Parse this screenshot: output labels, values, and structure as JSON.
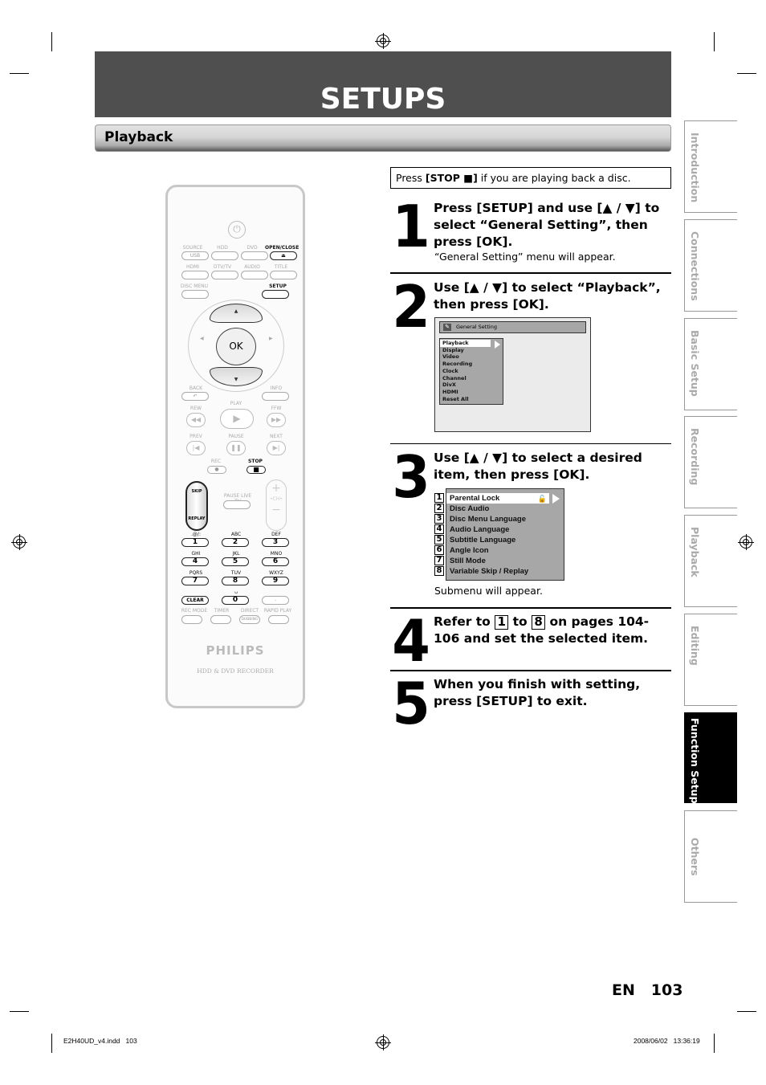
{
  "header": {
    "title": "SETUPS",
    "section": "Playback"
  },
  "note": {
    "prefix": "Press ",
    "key": "[STOP ■]",
    "suffix": " if you are playing back a disc."
  },
  "steps": [
    {
      "number": "1",
      "text": "Press [SETUP] and use [▲ / ▼] to select “General Setting”, then press [OK].",
      "sub": "“General Setting” menu will appear."
    },
    {
      "number": "2",
      "text": "Use [▲ / ▼] to select “Playback”, then press [OK]."
    },
    {
      "number": "3",
      "text": "Use [▲ / ▼] to select a desired item, then press [OK].",
      "sub": "Submenu will appear."
    },
    {
      "number": "4",
      "text_a": "Refer to ",
      "box_a": "1",
      "text_b": " to ",
      "box_b": "8",
      "text_c": " on pages 104-106 and set the selected item."
    },
    {
      "number": "5",
      "text": "When you finish with setting, press [SETUP] to exit."
    }
  ],
  "general_setting_screen": {
    "title": "General Setting",
    "items": [
      "Playback",
      "Display",
      "Video",
      "Recording",
      "Clock",
      "Channel",
      "DivX",
      "HDMI",
      "Reset All"
    ],
    "selected": "Playback"
  },
  "playback_menu": {
    "numbers": [
      "1",
      "2",
      "3",
      "4",
      "5",
      "6",
      "7",
      "8"
    ],
    "items": [
      "Parental Lock",
      "Disc Audio",
      "Disc Menu Language",
      "Audio Language",
      "Subtitle Language",
      "Angle Icon",
      "Still Mode",
      "Variable Skip / Replay"
    ],
    "selected": "Parental Lock",
    "lock_icon": "🔓"
  },
  "remote": {
    "brand": "PHILIPS",
    "model": "HDD & DVD RECORDER",
    "labels": {
      "source": "SOURCE",
      "usb": "USB",
      "hdd": "HDD",
      "dvd": "DVD",
      "open_close": "OPEN/CLOSE",
      "eject": "⏏",
      "hdmi": "HDMI",
      "dtv_tv": "DTV/TV",
      "audio": "AUDIO",
      "title": "TITLE",
      "disc_menu": "DISC MENU",
      "setup": "SETUP",
      "ok": "OK",
      "up": "▲",
      "down": "▼",
      "left": "◀",
      "right": "▶",
      "back": "BACK",
      "back_glyph": "↶",
      "info": "INFO",
      "play": "PLAY",
      "rew": "REW",
      "ffw": "FFW",
      "prev": "PREV",
      "pause": "PAUSE",
      "next": "NEXT",
      "rec": "REC",
      "stop": "STOP",
      "skip": "SKIP",
      "replay": "REPLAY",
      "pause_live_tv": "PAUSE LIVE TV",
      "ch": "•CH•",
      "plus": "+",
      "minus": "−",
      "clear": "CLEAR",
      "dash": "-",
      "rec_mode": "REC MODE",
      "timer": "TIMER",
      "direct": "DIRECT",
      "dubbing": "DUBBING",
      "rapid_play": "RAPID PLAY",
      "space": "␣"
    },
    "keypad": [
      {
        "label": ".@/:",
        "key": "1"
      },
      {
        "label": "ABC",
        "key": "2"
      },
      {
        "label": "DEF",
        "key": "3"
      },
      {
        "label": "GHI",
        "key": "4"
      },
      {
        "label": "JKL",
        "key": "5"
      },
      {
        "label": "MNO",
        "key": "6"
      },
      {
        "label": "PQRS",
        "key": "7"
      },
      {
        "label": "TUV",
        "key": "8"
      },
      {
        "label": "WXYZ",
        "key": "9"
      }
    ],
    "zero": "0"
  },
  "side_tabs": [
    {
      "label": "Introduction",
      "active": false
    },
    {
      "label": "Connections",
      "active": false
    },
    {
      "label": "Basic Setup",
      "active": false
    },
    {
      "label": "Recording",
      "active": false
    },
    {
      "label": "Playback",
      "active": false
    },
    {
      "label": "Editing",
      "active": false
    },
    {
      "label": "Function Setup",
      "active": true
    },
    {
      "label": "Others",
      "active": false
    }
  ],
  "page": {
    "lang": "EN",
    "number": "103"
  },
  "footer": {
    "file": "E2H40UD_v4.indd   103",
    "datetime": "2008/06/02   13:36:19"
  }
}
